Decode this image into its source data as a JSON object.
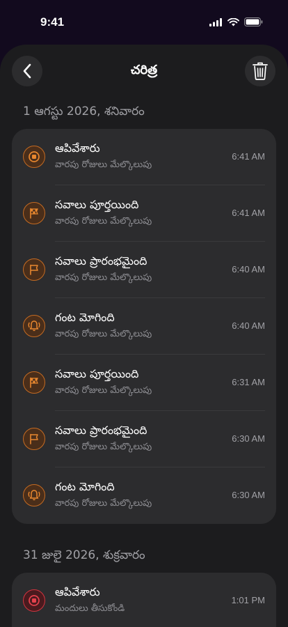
{
  "status": {
    "time": "9:41"
  },
  "header": {
    "title": "చరిత్ర"
  },
  "colors": {
    "orange": "#e8872f",
    "red": "#e5414d",
    "card": "#2c2c2e",
    "background": "#1c1c1e"
  },
  "sections": [
    {
      "date": "1 ఆగస్టు 2026, శనివారం",
      "events": [
        {
          "icon": "stop-circle-icon",
          "title": "ఆపివేశారు",
          "subtitle": "వారపు రోజులు మేల్కొలుపు",
          "time": "6:41 AM"
        },
        {
          "icon": "checkered-flag-icon",
          "title": "సవాలు పూర్తయింది",
          "subtitle": "వారపు రోజులు మేల్కొలుపు",
          "time": "6:41 AM"
        },
        {
          "icon": "flag-icon",
          "title": "సవాలు ప్రారంభమైంది",
          "subtitle": "వారపు రోజులు మేల్కొలుపు",
          "time": "6:40 AM"
        },
        {
          "icon": "ringing-bell-icon",
          "title": "గంట మోగింది",
          "subtitle": "వారపు రోజులు మేల్కొలుపు",
          "time": "6:40 AM"
        },
        {
          "icon": "checkered-flag-icon",
          "title": "సవాలు పూర్తయింది",
          "subtitle": "వారపు రోజులు మేల్కొలుపు",
          "time": "6:31 AM"
        },
        {
          "icon": "flag-icon",
          "title": "సవాలు ప్రారంభమైంది",
          "subtitle": "వారపు రోజులు మేల్కొలుపు",
          "time": "6:30 AM"
        },
        {
          "icon": "ringing-bell-icon",
          "title": "గంట మోగింది",
          "subtitle": "వారపు రోజులు మేల్కొలుపు",
          "time": "6:30 AM"
        }
      ]
    },
    {
      "date": "31 జులై 2026, శుక్రవారం",
      "events": [
        {
          "icon": "stop-circle-icon",
          "title": "ఆపివేశారు",
          "subtitle": "మందులు తీసుకోండి",
          "time": "1:01 PM"
        }
      ]
    }
  ]
}
